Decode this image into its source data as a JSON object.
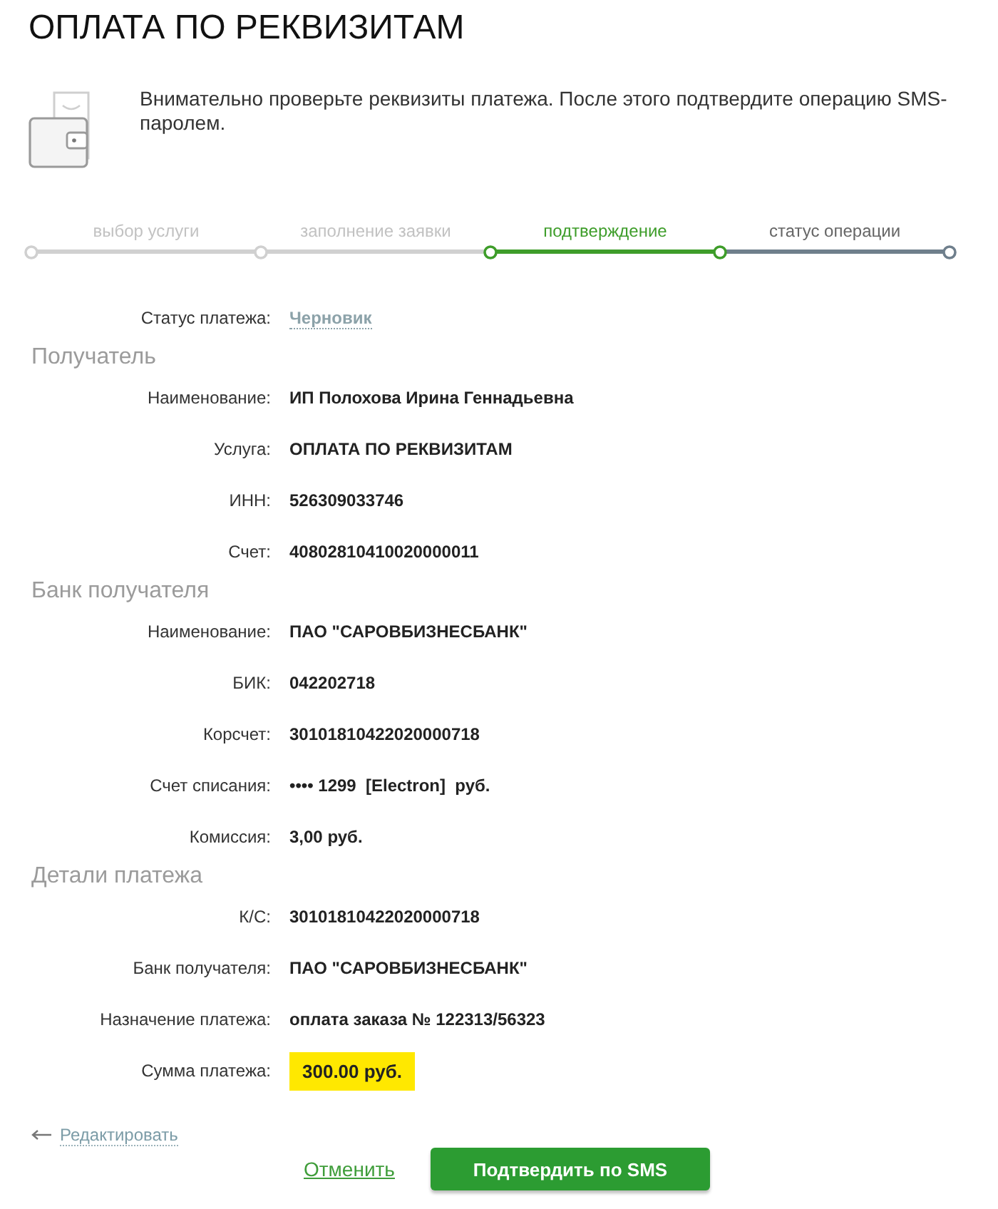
{
  "page": {
    "title": "ОПЛАТА ПО РЕКВИЗИТАМ"
  },
  "notice": {
    "text": "Внимательно проверьте реквизиты платежа. После этого подтвердите операцию SMS-паролем."
  },
  "steps": [
    {
      "label": "выбор услуги",
      "completed": true,
      "selected": false
    },
    {
      "label": "заполнение заявки",
      "completed": true,
      "selected": false
    },
    {
      "label": "подтверждение",
      "completed": false,
      "selected": true
    },
    {
      "label": "статус операции",
      "completed": false,
      "selected": false
    }
  ],
  "payment_status": {
    "label": "Статус платежа:",
    "value": "Черновик"
  },
  "sections": [
    {
      "title": "Получатель",
      "rows": [
        {
          "label": "Наименование:",
          "value": "ИП Полохова Ирина Геннадьевна",
          "highlighted": false
        },
        {
          "label": "Услуга:",
          "value": "ОПЛАТА ПО РЕКВИЗИТАМ",
          "highlighted": false
        },
        {
          "label": "ИНН:",
          "value": "526309033746",
          "highlighted": false
        },
        {
          "label": "Счет:",
          "value": "40802810410020000011",
          "highlighted": false
        }
      ]
    },
    {
      "title": "Банк получателя",
      "rows": [
        {
          "label": "Наименование:",
          "value": "ПАО \"САРОВБИЗНЕСБАНК\"",
          "highlighted": false
        },
        {
          "label": "БИК:",
          "value": "042202718",
          "highlighted": false
        },
        {
          "label": "Корсчет:",
          "value": "30101810422020000718",
          "highlighted": false
        },
        {
          "label": "Счет списания:",
          "value": "•••• 1299  [Electron]  руб.",
          "highlighted": false
        },
        {
          "label": "Комиссия:",
          "value": "3,00 руб.",
          "highlighted": false
        }
      ]
    },
    {
      "title": "Детали платежа",
      "rows": [
        {
          "label": "К/С:",
          "value": "30101810422020000718",
          "highlighted": false
        },
        {
          "label": "Банк получателя:",
          "value": "ПАО \"САРОВБИЗНЕСБАНК\"",
          "highlighted": false
        },
        {
          "label": "Назначение платежа:",
          "value": "оплата заказа № 122313/56323",
          "highlighted": false
        },
        {
          "label": "Сумма платежа:",
          "value": "300.00 руб.",
          "highlighted": true
        }
      ]
    }
  ],
  "actions": {
    "edit_link": "Редактировать",
    "cancel_link": "Отменить",
    "confirm_button": "Подтвердить по SMS"
  }
}
